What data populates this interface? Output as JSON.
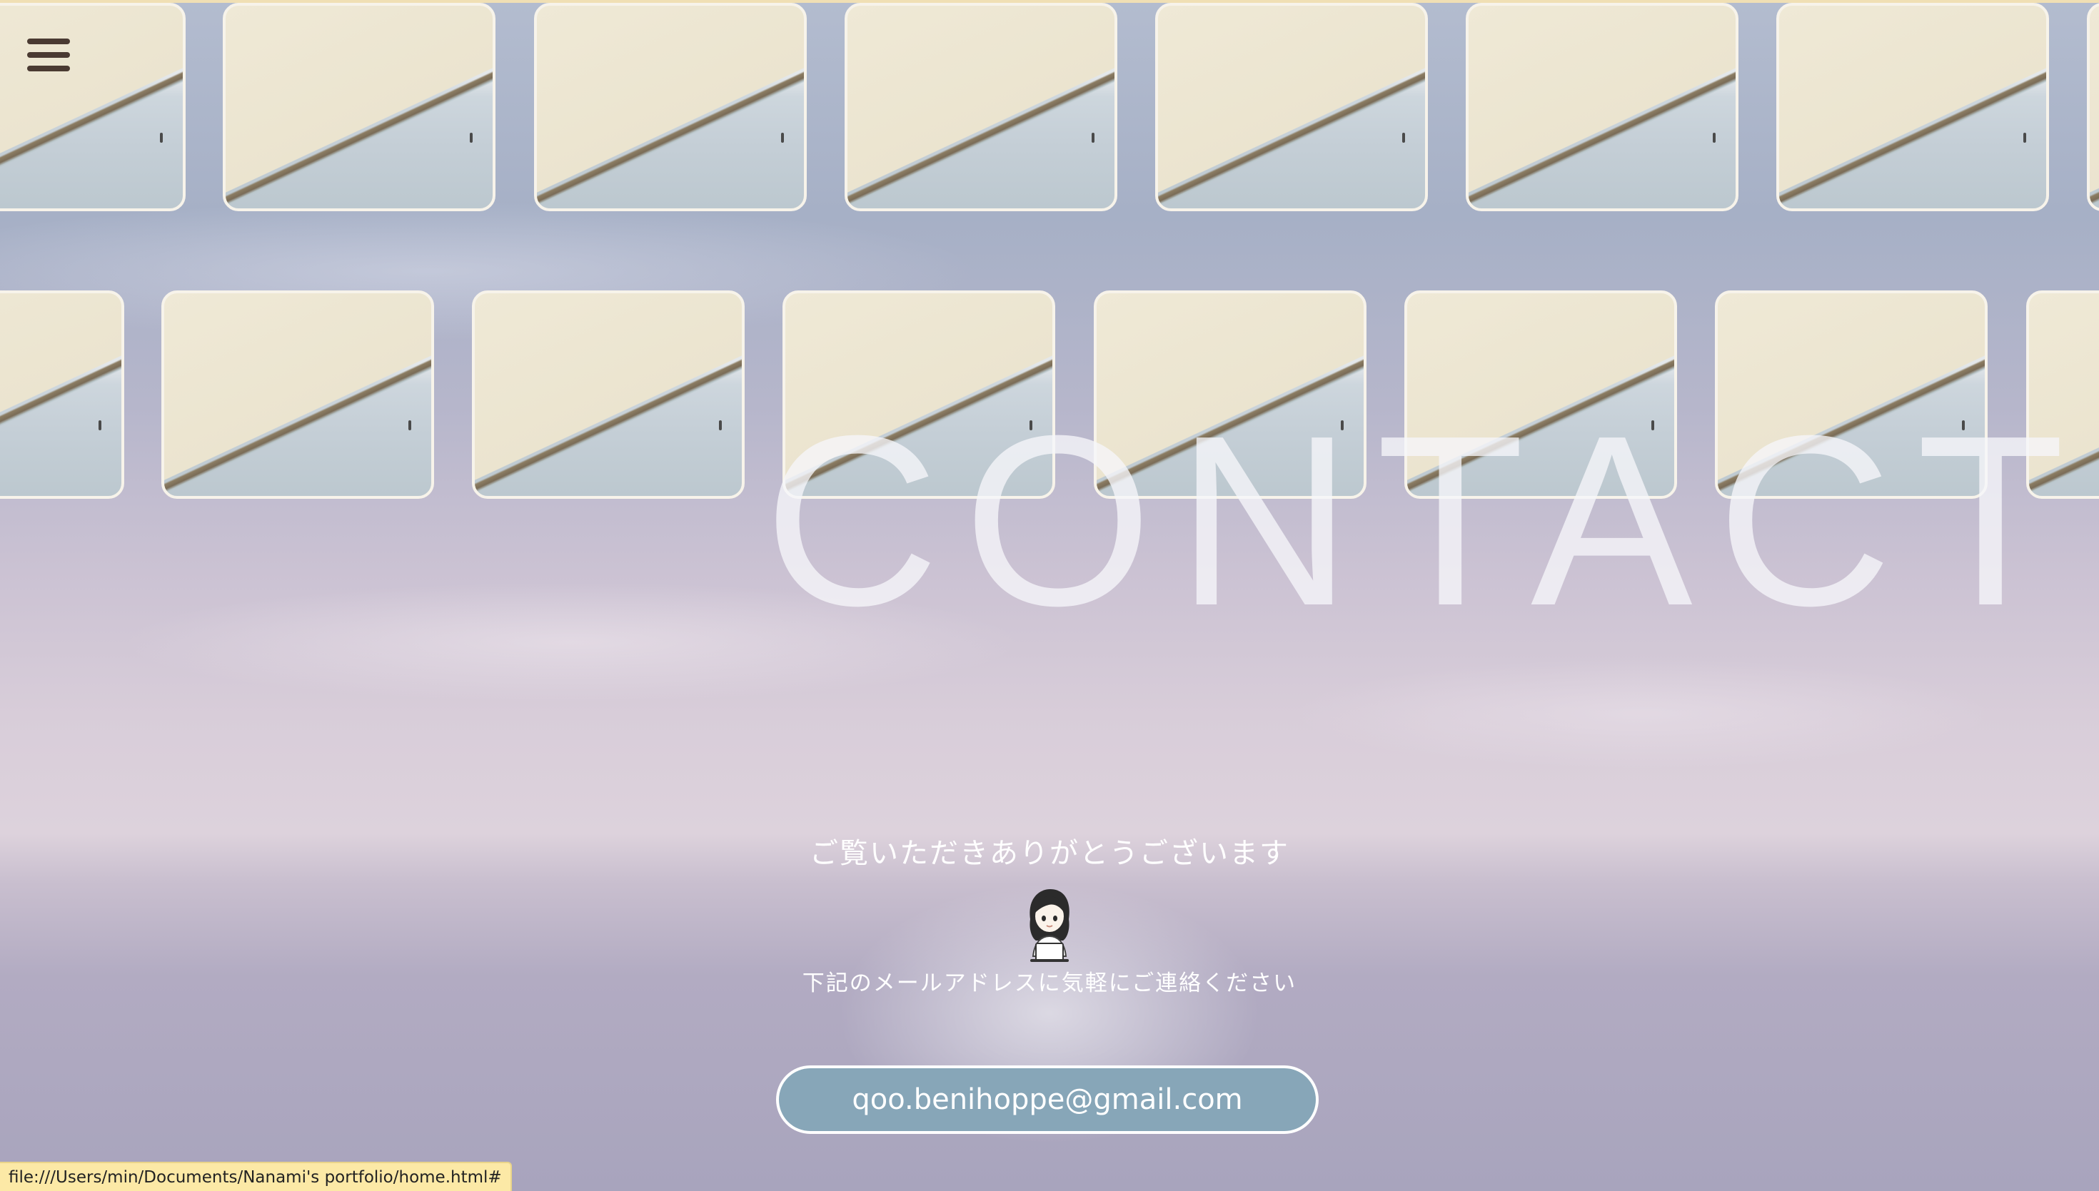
{
  "page": {
    "heading": "CONTACT",
    "thanks": "ご覧いただきありがとうございます",
    "mail_note": "下記のメールアドレスに気軽にご連絡ください",
    "email": "qoo.benihoppe@gmail.com"
  },
  "header": {
    "menu_icon": "hamburger-menu-icon"
  },
  "gallery": {
    "image_subject": "sand dune by the sea photo",
    "rows": 2
  },
  "avatar": {
    "icon": "girl-with-laptop-illustration"
  },
  "status_bar": {
    "url": "file:///Users/min/Documents/Nanami's portfolio/home.html#"
  },
  "colors": {
    "button_bg": "#87a6b8",
    "menu_icon": "#4a3a32",
    "status_bar_bg": "#fce9a6",
    "text": "#ffffff"
  }
}
